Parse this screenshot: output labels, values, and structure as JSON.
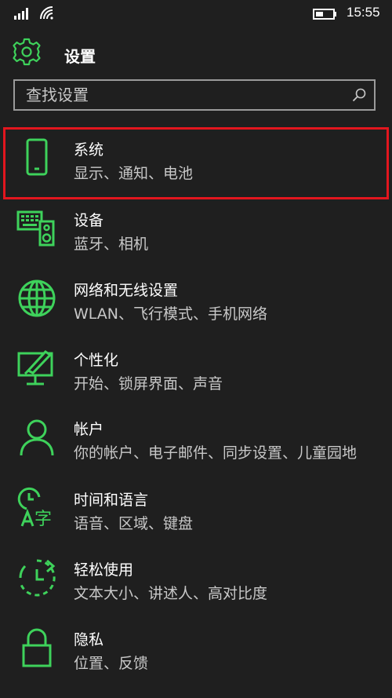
{
  "status_bar": {
    "time": "15:55"
  },
  "header": {
    "title": "设置"
  },
  "search": {
    "placeholder": "查找设置"
  },
  "colors": {
    "accent": "#3ed25b",
    "background": "#1f1f1f",
    "highlight": "#e2161e",
    "subtext": "#c8c8c8"
  },
  "items": [
    {
      "icon": "phone-icon",
      "title": "系统",
      "subtitle": "显示、通知、电池"
    },
    {
      "icon": "devices-icon",
      "title": "设备",
      "subtitle": "蓝牙、相机"
    },
    {
      "icon": "globe-icon",
      "title": "网络和无线设置",
      "subtitle": "WLAN、飞行模式、手机网络"
    },
    {
      "icon": "personalization-icon",
      "title": "个性化",
      "subtitle": "开始、锁屏界面、声音"
    },
    {
      "icon": "person-icon",
      "title": "帐户",
      "subtitle": "你的帐户、电子邮件、同步设置、儿童园地"
    },
    {
      "icon": "time-language-icon",
      "title": "时间和语言",
      "subtitle": "语音、区域、键盘"
    },
    {
      "icon": "ease-of-access-icon",
      "title": "轻松使用",
      "subtitle": "文本大小、讲述人、高对比度"
    },
    {
      "icon": "lock-icon",
      "title": "隐私",
      "subtitle": "位置、反馈"
    }
  ]
}
